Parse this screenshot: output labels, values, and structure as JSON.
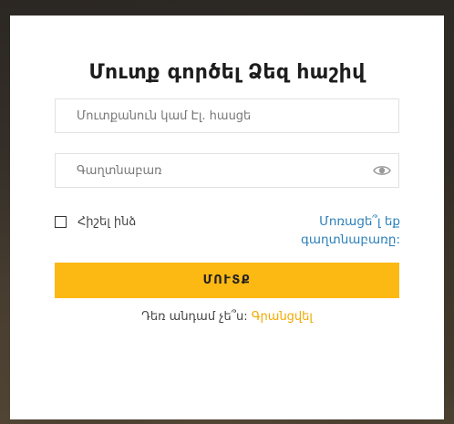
{
  "login": {
    "title": "Մուտք գործել Ձեզ հաշիվ",
    "username_placeholder": "Մուտքանուն կամ Էլ. հասցե",
    "password_placeholder": "Գաղտնաբառ",
    "remember_label": "Հիշել ինձ",
    "forgot_line1": "Մոռացե՞լ եք",
    "forgot_line2": "գաղտնաբառը:",
    "submit_label": "ՄՈՒՏՔ",
    "no_account_text": "Դեռ անդամ չե՞ս:",
    "register_link": "Գրանցվել"
  },
  "colors": {
    "accent": "#fcb813",
    "link_blue": "#2a7fb8",
    "register_link": "#f2a900"
  },
  "icons": {
    "password_toggle": "eye-icon"
  }
}
